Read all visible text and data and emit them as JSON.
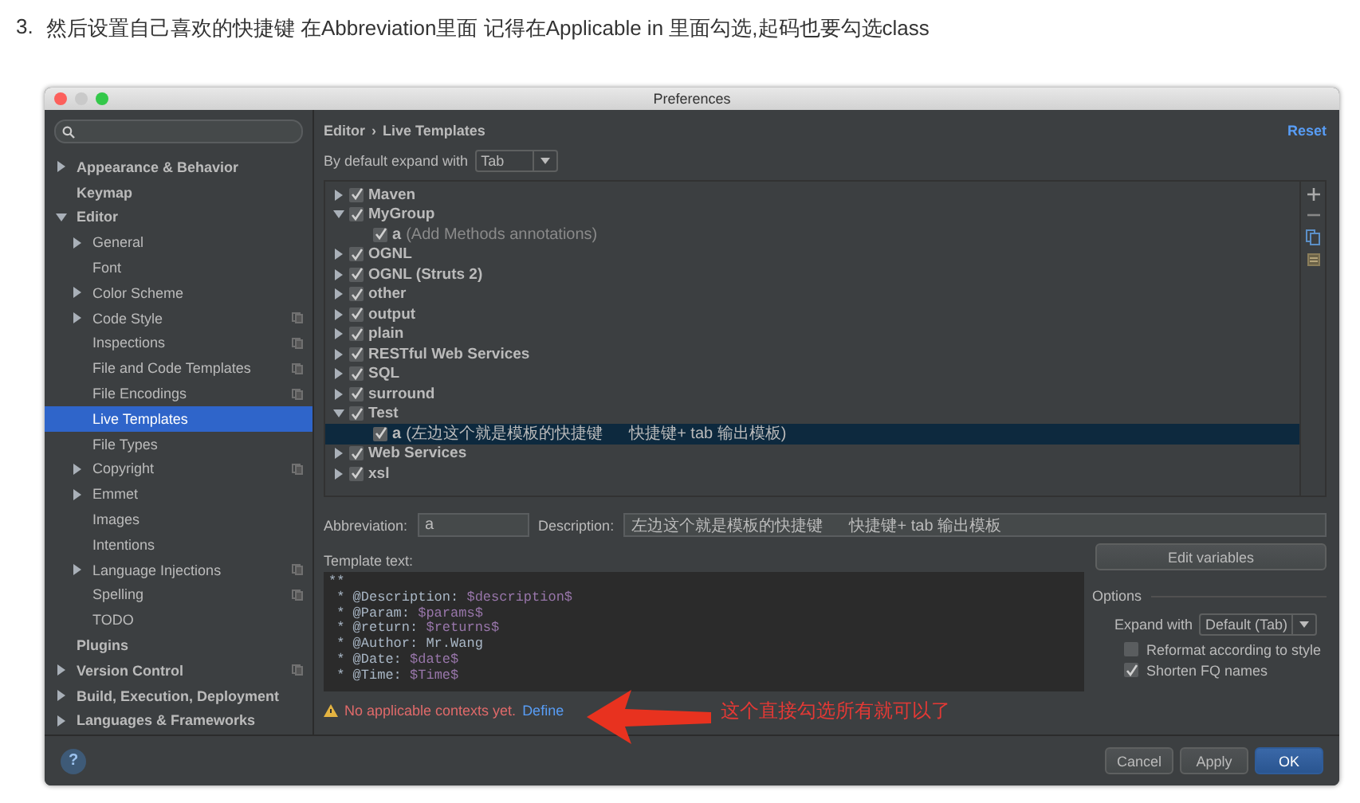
{
  "heading": {
    "number": "3.",
    "text": "然后设置自己喜欢的快捷键 在Abbreviation里面 记得在Applicable in 里面勾选,起码也要勾选class"
  },
  "window": {
    "title": "Preferences"
  },
  "sidebar": {
    "items": [
      {
        "label": "Appearance & Behavior",
        "expandable": true,
        "expanded": false,
        "selected": false,
        "project_scoped": false
      },
      {
        "label": "Keymap",
        "expandable": false,
        "selected": false,
        "project_scoped": false
      },
      {
        "label": "Editor",
        "expandable": true,
        "expanded": true,
        "selected": false,
        "project_scoped": false,
        "children": [
          {
            "label": "General",
            "expandable": true,
            "expanded": false,
            "selected": false,
            "project_scoped": false
          },
          {
            "label": "Font",
            "expandable": false,
            "selected": false,
            "project_scoped": false
          },
          {
            "label": "Color Scheme",
            "expandable": true,
            "expanded": false,
            "selected": false,
            "project_scoped": false
          },
          {
            "label": "Code Style",
            "expandable": true,
            "expanded": false,
            "selected": false,
            "project_scoped": true
          },
          {
            "label": "Inspections",
            "expandable": false,
            "selected": false,
            "project_scoped": true
          },
          {
            "label": "File and Code Templates",
            "expandable": false,
            "selected": false,
            "project_scoped": true
          },
          {
            "label": "File Encodings",
            "expandable": false,
            "selected": false,
            "project_scoped": true
          },
          {
            "label": "Live Templates",
            "expandable": false,
            "selected": true,
            "project_scoped": false
          },
          {
            "label": "File Types",
            "expandable": false,
            "selected": false,
            "project_scoped": false
          },
          {
            "label": "Copyright",
            "expandable": true,
            "expanded": false,
            "selected": false,
            "project_scoped": true
          },
          {
            "label": "Emmet",
            "expandable": true,
            "expanded": false,
            "selected": false,
            "project_scoped": false
          },
          {
            "label": "Images",
            "expandable": false,
            "selected": false,
            "project_scoped": false
          },
          {
            "label": "Intentions",
            "expandable": false,
            "selected": false,
            "project_scoped": false
          },
          {
            "label": "Language Injections",
            "expandable": true,
            "expanded": false,
            "selected": false,
            "project_scoped": true
          },
          {
            "label": "Spelling",
            "expandable": false,
            "selected": false,
            "project_scoped": true
          },
          {
            "label": "TODO",
            "expandable": false,
            "selected": false,
            "project_scoped": false
          }
        ]
      },
      {
        "label": "Plugins",
        "expandable": false,
        "selected": false,
        "project_scoped": false
      },
      {
        "label": "Version Control",
        "expandable": true,
        "expanded": false,
        "selected": false,
        "project_scoped": true
      },
      {
        "label": "Build, Execution, Deployment",
        "expandable": true,
        "expanded": false,
        "selected": false,
        "project_scoped": false
      },
      {
        "label": "Languages & Frameworks",
        "expandable": true,
        "expanded": false,
        "selected": false,
        "project_scoped": false
      }
    ]
  },
  "breadcrumb": {
    "parent": "Editor",
    "separator": "›",
    "current": "Live Templates"
  },
  "reset": "Reset",
  "expand_default": {
    "label": "By default expand with",
    "value": "Tab"
  },
  "template_groups": [
    {
      "name": "Maven",
      "checked": true,
      "expanded": false
    },
    {
      "name": "MyGroup",
      "checked": true,
      "expanded": true,
      "children": [
        {
          "abbreviation": "a",
          "description": "(Add Methods annotations)",
          "checked": true,
          "selected": false
        }
      ]
    },
    {
      "name": "OGNL",
      "checked": true,
      "expanded": false
    },
    {
      "name": "OGNL (Struts 2)",
      "checked": true,
      "expanded": false
    },
    {
      "name": "other",
      "checked": true,
      "expanded": false
    },
    {
      "name": "output",
      "checked": true,
      "expanded": false
    },
    {
      "name": "plain",
      "checked": true,
      "expanded": false
    },
    {
      "name": "RESTful Web Services",
      "checked": true,
      "expanded": false
    },
    {
      "name": "SQL",
      "checked": true,
      "expanded": false
    },
    {
      "name": "surround",
      "checked": true,
      "expanded": false
    },
    {
      "name": "Test",
      "checked": true,
      "expanded": true,
      "children": [
        {
          "abbreviation": "a",
          "description": "(左边这个就是模板的快捷键      快捷键+ tab 输出模板)",
          "checked": true,
          "selected": true
        }
      ]
    },
    {
      "name": "Web Services",
      "checked": true,
      "expanded": false
    },
    {
      "name": "xsl",
      "checked": true,
      "expanded": false
    }
  ],
  "abbreviation": {
    "label": "Abbreviation:",
    "value": "a"
  },
  "description": {
    "label": "Description:",
    "value": "左边这个就是模板的快捷键      快捷键+ tab 输出模板"
  },
  "template_text": {
    "label": "Template text:",
    "lines": [
      [
        {
          "kind": "plain",
          "text": "**"
        }
      ],
      [
        {
          "kind": "plain",
          "text": " * @Description: "
        },
        {
          "kind": "var",
          "text": "$description$"
        }
      ],
      [
        {
          "kind": "plain",
          "text": " * @Param: "
        },
        {
          "kind": "var",
          "text": "$params$"
        }
      ],
      [
        {
          "kind": "plain",
          "text": " * @return: "
        },
        {
          "kind": "var",
          "text": "$returns$"
        }
      ],
      [
        {
          "kind": "plain",
          "text": " * @Author: Mr.Wang"
        }
      ],
      [
        {
          "kind": "plain",
          "text": " * @Date: "
        },
        {
          "kind": "var",
          "text": "$date$"
        }
      ],
      [
        {
          "kind": "plain",
          "text": " * @Time: "
        },
        {
          "kind": "var",
          "text": "$Time$"
        }
      ]
    ]
  },
  "edit_variables": "Edit variables",
  "options": {
    "title": "Options",
    "expand_label": "Expand with",
    "expand_value": "Default (Tab)",
    "checkboxes": [
      {
        "label": "Reformat according to style",
        "checked": false
      },
      {
        "label": "Shorten FQ names",
        "checked": true
      }
    ]
  },
  "warning": {
    "text": "No applicable contexts yet.",
    "link": "Define"
  },
  "annotation": "这个直接勾选所有就可以了",
  "help": "?",
  "buttons": [
    {
      "label": "Cancel",
      "primary": false
    },
    {
      "label": "Apply",
      "primary": false
    },
    {
      "label": "OK",
      "primary": true
    }
  ]
}
